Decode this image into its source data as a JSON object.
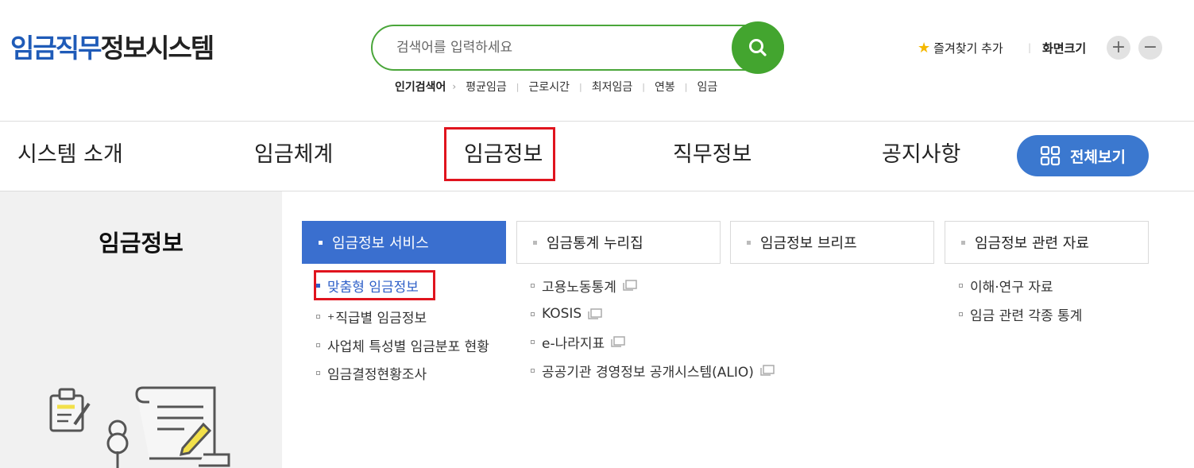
{
  "header": {
    "logo_blue": "임금직무",
    "logo_dark": "정보시스템",
    "search": {
      "placeholder": "검색어를 입력하세요"
    },
    "popular": {
      "label": "인기검색어",
      "keywords": [
        "평균임금",
        "근로시간",
        "최저임금",
        "연봉",
        "임금"
      ]
    },
    "favorite_label": "즐겨찾기 추가",
    "zoom_label": "화면크기",
    "zoom_in": "+",
    "zoom_out": "−"
  },
  "gnb": {
    "items": [
      "시스템 소개",
      "임금체계",
      "임금정보",
      "직무정보",
      "공지사항"
    ],
    "active": "임금정보",
    "all_label": "전체보기"
  },
  "side": {
    "title": "임금정보"
  },
  "tabs": [
    {
      "label": "임금정보 서비스",
      "active": true
    },
    {
      "label": "임금통계 누리집",
      "active": false
    },
    {
      "label": "임금정보 브리프",
      "active": false
    },
    {
      "label": "임금정보 관련 자료",
      "active": false
    }
  ],
  "sub_service": [
    {
      "label": "맞춤형 임금정보",
      "current": true
    },
    {
      "prefix": "+",
      "label": "직급별 임금정보"
    },
    {
      "label": "사업체 특성별 임금분포 현황"
    },
    {
      "label": "임금결정현황조사"
    }
  ],
  "sub_stats": [
    {
      "label": "고용노동통계",
      "external": true
    },
    {
      "label": "KOSIS",
      "external": true
    },
    {
      "label": "e-나라지표",
      "external": true
    },
    {
      "label": "공공기관 경영정보 공개시스템(ALIO)",
      "external": true
    }
  ],
  "sub_materials": [
    {
      "label": "이해·연구 자료"
    },
    {
      "label": "임금 관련 각종 통계"
    }
  ],
  "colors": {
    "brand_blue": "#1f5bb8",
    "search_green": "#43a52f",
    "active_tab": "#3a6fcf",
    "highlight_red": "#e0141e"
  }
}
